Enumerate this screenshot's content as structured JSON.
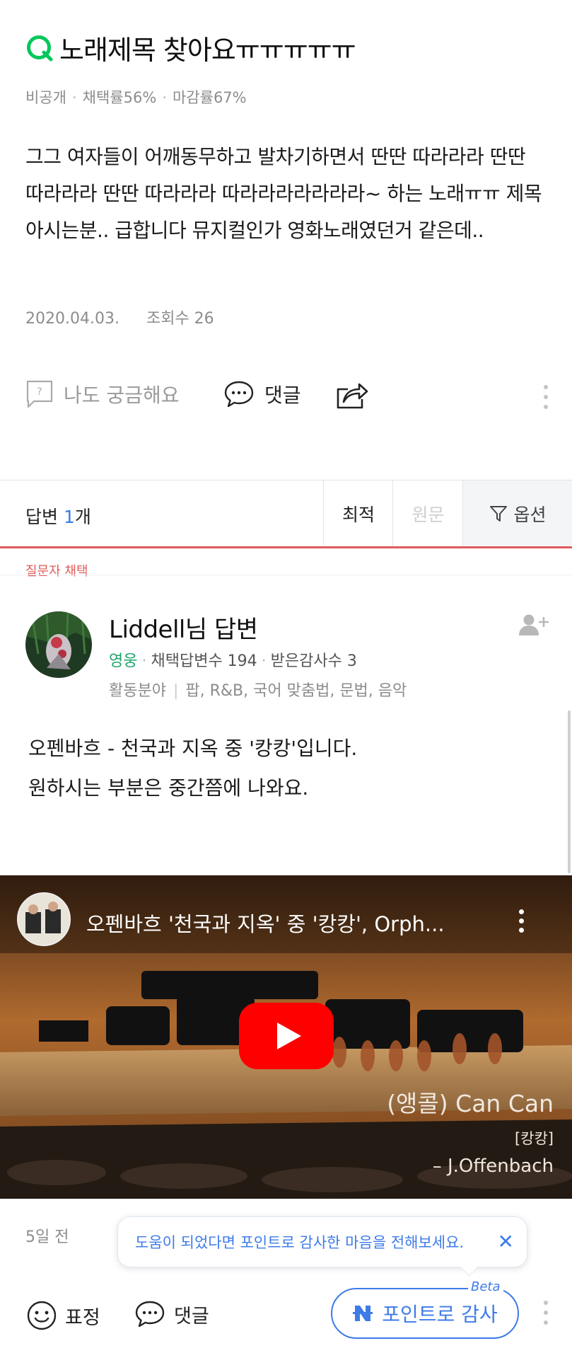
{
  "question": {
    "title": "노래제목 찾아요ㅠㅠㅠㅠㅠ",
    "meta": [
      "비공개",
      "채택률56%",
      "마감률67%"
    ],
    "body": "그그 여자들이 어깨동무하고 발차기하면서 딴딴 따라라라 딴딴 따라라라 딴딴 따라라라 따라라라라라라라~ 하는 노래ㅠㅠ 제목 아시는분.. 급합니다 뮤지컬인가 영화노래였던거 같은데..",
    "date": "2020.04.03.",
    "views": "조회수 26",
    "actions": {
      "curious": "나도 궁금해요",
      "comment": "댓글"
    }
  },
  "answers_bar": {
    "label": "답변",
    "count": "1",
    "unit": "개",
    "sort_best": "최적",
    "sort_original": "원문",
    "options": "옵션"
  },
  "answer": {
    "chosen_label": "질문자 채택",
    "author": "Liddell님 답변",
    "grade": "영웅",
    "adopted": "채택답변수 194",
    "thanks": "받은감사수 3",
    "field_label": "활동분야",
    "fields": "팝, R&B, 국어 맞춤법, 문법, 음악",
    "lines": [
      "오펜바흐 - 천국과 지옥 중 '캉캉'입니다.",
      "원하시는 부분은 중간쯤에 나와요."
    ],
    "video": {
      "title": "오펜바흐 '천국과 지옥' 중 '캉캉', Orph...",
      "caption_main": "(앵콜) Can Can",
      "caption_sub": "[캉캉]",
      "caption_composer": "– J.Offenbach"
    },
    "posted_ago": "5일 전",
    "tooltip": "도움이 되었다면 포인트로 감사한 마음을 전해보세요.",
    "tooltip_close": "✕",
    "emotion": "표정",
    "comment": "댓글",
    "point_button": "포인트로 감사",
    "beta": "Beta"
  },
  "colors": {
    "green_q": "#03c75a",
    "accent_blue": "#3d7be8",
    "accent_red": "#e05b5b",
    "grade_green": "#1fa36b",
    "youtube_red": "#ff0000"
  },
  "icons": [
    "q-icon",
    "question-box-icon",
    "speech-bubble-icon",
    "share-icon",
    "more-vertical-icon",
    "filter-icon",
    "add-user-icon",
    "smile-icon",
    "naver-n-icon",
    "play-icon"
  ]
}
